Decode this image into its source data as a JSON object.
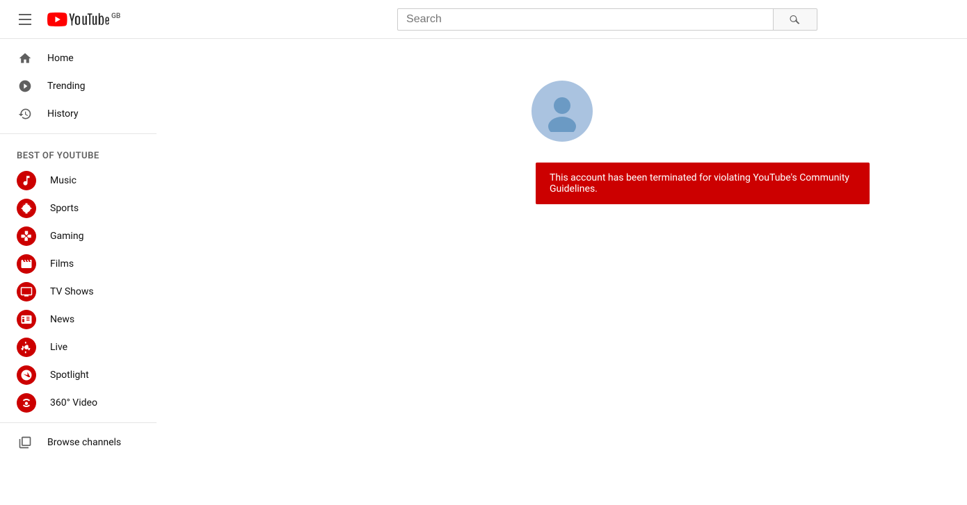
{
  "header": {
    "search_placeholder": "Search",
    "logo_alt": "YouTube GB"
  },
  "sidebar": {
    "top_items": [
      {
        "id": "home",
        "label": "Home",
        "icon": "home"
      },
      {
        "id": "trending",
        "label": "Trending",
        "icon": "trending"
      },
      {
        "id": "history",
        "label": "History",
        "icon": "history"
      }
    ],
    "section_title": "BEST OF YOUTUBE",
    "best_items": [
      {
        "id": "music",
        "label": "Music",
        "icon": "music"
      },
      {
        "id": "sports",
        "label": "Sports",
        "icon": "sports"
      },
      {
        "id": "gaming",
        "label": "Gaming",
        "icon": "gaming"
      },
      {
        "id": "films",
        "label": "Films",
        "icon": "films"
      },
      {
        "id": "tv-shows",
        "label": "TV Shows",
        "icon": "tv"
      },
      {
        "id": "news",
        "label": "News",
        "icon": "news"
      },
      {
        "id": "live",
        "label": "Live",
        "icon": "live"
      },
      {
        "id": "spotlight",
        "label": "Spotlight",
        "icon": "spotlight"
      },
      {
        "id": "360-video",
        "label": "360° Video",
        "icon": "360"
      }
    ],
    "bottom_items": [
      {
        "id": "browse-channels",
        "label": "Browse channels",
        "icon": "browse"
      }
    ]
  },
  "main": {
    "terminated_message": "This account has been terminated for violating YouTube's Community Guidelines."
  }
}
